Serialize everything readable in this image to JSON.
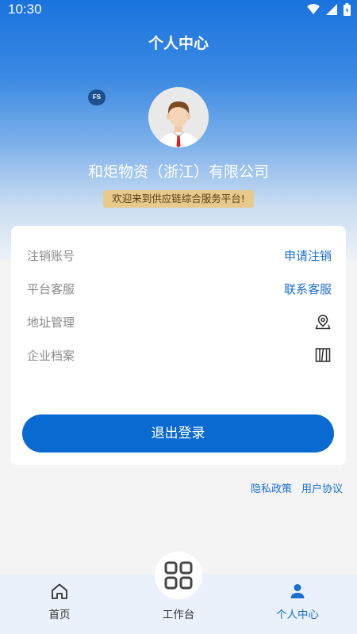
{
  "status_bar": {
    "time": "10:30"
  },
  "header": {
    "title": "个人中心"
  },
  "profile": {
    "badge": "FS",
    "company_name": "和炬物资（浙江）有限公司",
    "welcome": "欢迎来到供应链综合服务平台!"
  },
  "menu": {
    "items": [
      {
        "label": "注销账号",
        "action": "申请注销"
      },
      {
        "label": "平台客服",
        "action": "联系客服"
      },
      {
        "label": "地址管理",
        "icon": "location-pin-icon"
      },
      {
        "label": "企业档案",
        "icon": "archive-books-icon"
      }
    ],
    "logout_label": "退出登录"
  },
  "links": {
    "privacy": "隐私政策",
    "agreement": "用户协议"
  },
  "tabbar": {
    "items": [
      {
        "label": "首页",
        "icon": "home-icon"
      },
      {
        "label": "工作台",
        "icon": "grid-icon"
      },
      {
        "label": "个人中心",
        "icon": "person-icon"
      }
    ],
    "active_color": "#1a6fd1"
  }
}
